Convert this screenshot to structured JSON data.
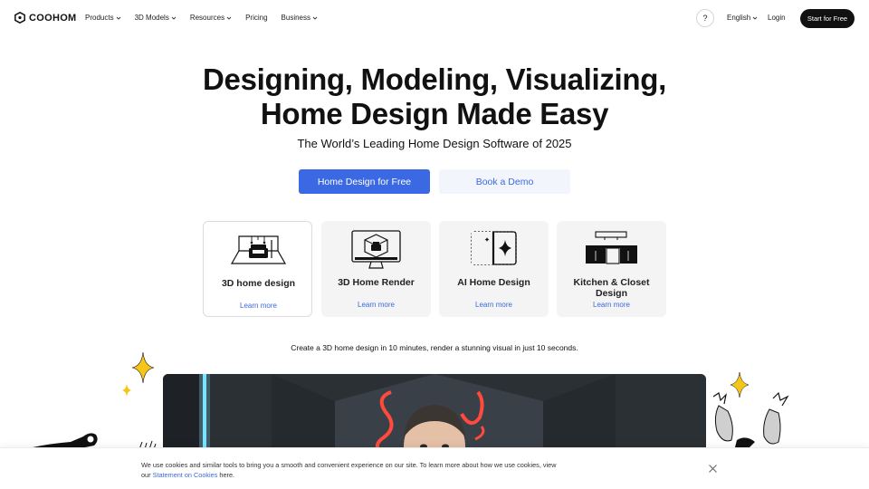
{
  "nav": {
    "brand": "COOHOM",
    "menu": [
      {
        "label": "Products",
        "has_dropdown": true
      },
      {
        "label": "3D Models",
        "has_dropdown": true
      },
      {
        "label": "Resources",
        "has_dropdown": true
      },
      {
        "label": "Pricing",
        "has_dropdown": false
      },
      {
        "label": "Business",
        "has_dropdown": true
      }
    ],
    "help_label": "?",
    "language": "English",
    "login": "Login",
    "start_label": "Start for Free"
  },
  "hero": {
    "title_line1": "Designing, Modeling, Visualizing,",
    "title_line2": "Home Design Made Easy",
    "subtitle": "The World’s Leading Home Design Software of 2025",
    "primary_cta": "Home Design for Free",
    "secondary_cta": "Book a Demo"
  },
  "cards": [
    {
      "title": "3D home design",
      "link": "Learn more",
      "icon": "3d-room-icon",
      "active": true
    },
    {
      "title": "3D Home Render",
      "link": "Learn more",
      "icon": "monitor-render-icon",
      "active": false
    },
    {
      "title": "AI Home Design",
      "link": "Learn more",
      "icon": "ai-sparkle-icon",
      "active": false
    },
    {
      "title": "Kitchen & Closet Design",
      "link": "Learn more",
      "icon": "kitchen-cabinet-icon",
      "active": false
    }
  ],
  "tagline": "Create a 3D home design in 10 minutes, render a stunning visual in just 10 seconds.",
  "cookie": {
    "text_before": "We use cookies and similar tools to bring you a smooth and convenient experience on our site. To learn more about how we use cookies, view our",
    "link": "Statement on Cookies",
    "text_after": "here."
  },
  "colors": {
    "accent": "#3b69e3",
    "accent_soft": "#f2f5fb",
    "dark": "#111111",
    "card_bg": "#f4f4f4",
    "sparkle": "#f5c518"
  }
}
